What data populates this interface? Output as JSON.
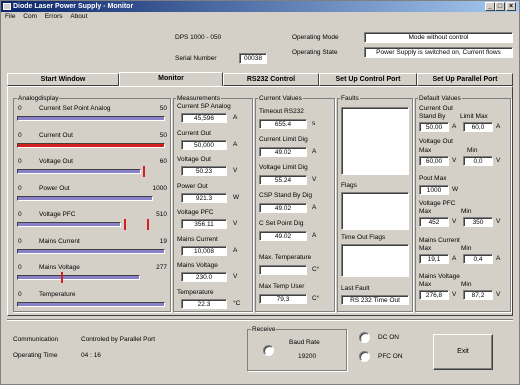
{
  "window": {
    "title": "Diode Laser Power Supply - Monitor",
    "minimize": "_",
    "maximize": "□",
    "close": "×"
  },
  "menu": [
    "File",
    "Com",
    "Errors",
    "About"
  ],
  "header": {
    "model": "DPS    1000  -  050",
    "serial_label": "Serial Number",
    "serial_value": "00038",
    "mode_label": "Operating Mode",
    "mode_value": "Mode without control",
    "state_label": "Operating State",
    "state_value": "Power Supply is switched on, Current flows"
  },
  "tabs": [
    "Start Window",
    "Monitor",
    "RS232 Control",
    "Set Up Control Port",
    "Set Up Parallel Port"
  ],
  "analog": {
    "title": "Analogdisplay",
    "rows": [
      {
        "min": "0",
        "label": "Current Set Point Analog",
        "max": "50",
        "level": 1.0,
        "color": "#8880c8"
      },
      {
        "min": "0",
        "label": "Current Out",
        "max": "50",
        "level": 1.0,
        "color": "#d42020"
      },
      {
        "min": "0",
        "label": "Voltage Out",
        "max": "60",
        "level": 0.84,
        "color": "#8880c8",
        "marker": 0.85
      },
      {
        "min": "0",
        "label": "Power Out",
        "max": "1000",
        "level": 0.92,
        "color": "#8880c8"
      },
      {
        "min": "0",
        "label": "Voltage PFC",
        "max": "510",
        "level": 0.7,
        "color": "#8880c8",
        "marker": 0.72,
        "marker2": 0.88
      },
      {
        "min": "0",
        "label": "Mains Current",
        "max": "19",
        "level": 1.0,
        "color": "#8880c8"
      },
      {
        "min": "0",
        "label": "Mains Voltage",
        "max": "277",
        "level": 0.83,
        "color": "#8880c8",
        "marker": 0.3
      },
      {
        "min": "0",
        "label": "Temperature",
        "max": "",
        "level": 1.0,
        "color": "#8880c8"
      }
    ]
  },
  "measurements": {
    "title": "Measurements",
    "items": [
      {
        "label": "Current SP Analog",
        "value": "45,596",
        "unit": "A"
      },
      {
        "label": "Current Out",
        "value": "50,000",
        "unit": "A"
      },
      {
        "label": "Voltage Out",
        "value": "50.23",
        "unit": "V"
      },
      {
        "label": "Power Out",
        "value": "921.3",
        "unit": "W"
      },
      {
        "label": "Voltage PFC",
        "value": "356.11",
        "unit": "V"
      },
      {
        "label": "Mains Current",
        "value": "10,008",
        "unit": "A"
      },
      {
        "label": "Mains Voltage",
        "value": "230.0",
        "unit": "V"
      },
      {
        "label": "Temperature",
        "value": "22.3",
        "unit": "°C"
      }
    ]
  },
  "current_values": {
    "title": "Current Values",
    "items": [
      {
        "label": "Timeout RS232",
        "value": "655.4",
        "unit": "s"
      },
      {
        "label": "Current Limit Dig",
        "value": "49.02",
        "unit": "A"
      },
      {
        "label": "Voltage Limit Dig",
        "value": "55.24",
        "unit": "V"
      },
      {
        "label": "CSP Stand By Dig",
        "value": "49.02",
        "unit": "A"
      },
      {
        "label": "C Set Point Dig",
        "value": "49.02",
        "unit": "A"
      }
    ],
    "max_temp_label": "Max. Temperature",
    "max_temp_value": "",
    "max_temp_unit": "C°",
    "max_temp_user_label": "Max Temp User",
    "max_temp_user_value": "79,3",
    "max_temp_user_unit": "C°"
  },
  "faults": {
    "title": "Faults",
    "flags_label": "Flags",
    "timeout_flags_label": "Time Out Flags",
    "last_fault_label": "Last Fault",
    "last_fault_value": "RS 232 Time Out"
  },
  "defaults": {
    "title": "Default Values",
    "current_out_label": "Current Out",
    "standby_label": "Stand By",
    "limit_max_label": "Limit Max",
    "standby_value": "50,00",
    "standby_unit": "A",
    "limit_max_value": "60,0",
    "limit_max_unit": "A",
    "voltage_out_label": "Voltage Out",
    "vo_max_label": "Max",
    "vo_min_label": "Min",
    "vo_max_value": "60,00",
    "vo_max_unit": "V",
    "vo_min_value": "0,0",
    "vo_min_unit": "V",
    "pout_label": "Pout Max",
    "pout_value": "1000",
    "pout_unit": "W",
    "vpfc_label": "Voltage PFC",
    "vpfc_max_label": "Max",
    "vpfc_min_label": "Min",
    "vpfc_max_value": "452",
    "vpfc_max_unit": "V",
    "vpfc_min_value": "350",
    "vpfc_min_unit": "V",
    "mc_label": "Mains Current",
    "mc_max_label": "Max",
    "mc_min_label": "Min",
    "mc_max_value": "19,1",
    "mc_max_unit": "A",
    "mc_min_value": "0,4",
    "mc_min_unit": "A",
    "mv_label": "Mains Voltage",
    "mv_max_label": "Max",
    "mv_min_label": "Min",
    "mv_max_value": "276,8",
    "mv_max_unit": "V",
    "mv_min_value": "87,2",
    "mv_min_unit": "V"
  },
  "status": {
    "communication_label": "Communication",
    "communication_value": "Controled by Parallel Port",
    "operating_time_label": "Operating Time",
    "operating_time_value": "04 : 16",
    "receive_label": "Receive",
    "baud_label": "Baud Rate",
    "baud_value": "19200",
    "dc_on_label": "DC ON",
    "pfc_on_label": "PFC ON",
    "exit_label": "Exit"
  }
}
